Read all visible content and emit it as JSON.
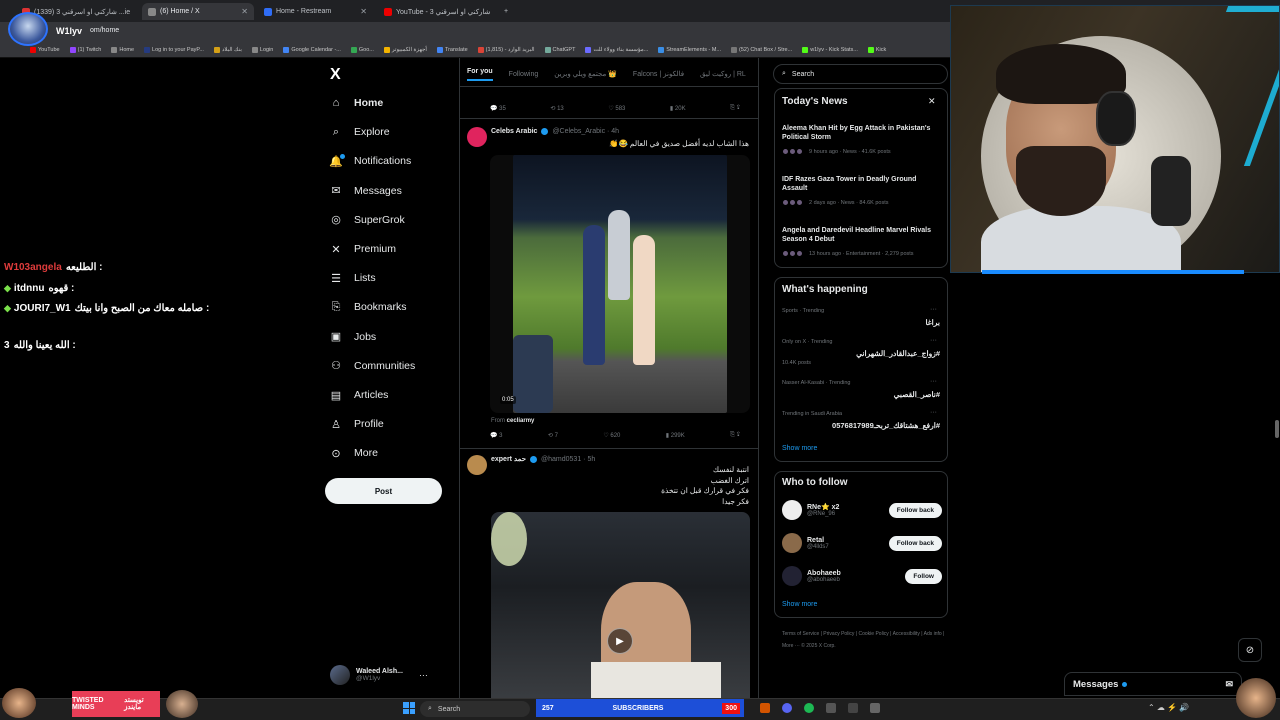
{
  "browser": {
    "tabs": [
      {
        "label": "شاركني او اسرقني 3 (1339) ...ie",
        "color": "#d33"
      },
      {
        "label": "(6) Home / X",
        "color": "#888"
      },
      {
        "label": "Home - Restream",
        "color": "#2f6df6"
      },
      {
        "label": "YouTube - شاركني او اسرقني 3",
        "color": "#e00"
      }
    ],
    "url": "om/home",
    "streamer_name": "W1lyv",
    "bookmarks": [
      "YouTube",
      "(1) Twitch",
      "Home",
      "Log in to your PayP...",
      "بنك البلاد",
      "Login",
      "Google Calendar -...",
      "Goo...",
      "أجهزة الكمبيوتر",
      "Translate",
      "البريد الوارد - (1,815)",
      "ChatGPT",
      "مؤسسة بناء وولاء للت...",
      "StreamElements - M...",
      "(52) Chat Box / Stre...",
      "w1lyv - Kick Stats...",
      "Kick"
    ]
  },
  "chat": [
    {
      "user": "W103angela",
      "msg": "الطليعه :",
      "color": "#e03c3c",
      "badge": false
    },
    {
      "user": "itdnnu",
      "msg": "قهوه :",
      "color": "#ffffff",
      "badge": true
    },
    {
      "user": "JOURI7_W1",
      "msg": "صامله معاك من الصبح وانا بيتك :",
      "color": "#ffffff",
      "badge": true
    },
    {
      "user": "3",
      "msg": "الله يعينا والله :",
      "color": "#ffffff",
      "badge": false
    }
  ],
  "nav": {
    "logo": "X",
    "items": [
      {
        "label": "Home",
        "icon": "home-icon",
        "glyph": "⌂"
      },
      {
        "label": "Explore",
        "icon": "search-icon",
        "glyph": "⌕"
      },
      {
        "label": "Notifications",
        "icon": "bell-icon",
        "glyph": "🔔"
      },
      {
        "label": "Messages",
        "icon": "mail-icon",
        "glyph": "✉"
      },
      {
        "label": "SuperGrok",
        "icon": "grok-icon",
        "glyph": "◎"
      },
      {
        "label": "Premium",
        "icon": "x-premium-icon",
        "glyph": "✕"
      },
      {
        "label": "Lists",
        "icon": "list-icon",
        "glyph": "☰"
      },
      {
        "label": "Bookmarks",
        "icon": "bookmark-icon",
        "glyph": "⎘"
      },
      {
        "label": "Jobs",
        "icon": "briefcase-icon",
        "glyph": "▣"
      },
      {
        "label": "Communities",
        "icon": "people-icon",
        "glyph": "⚇"
      },
      {
        "label": "Articles",
        "icon": "article-icon",
        "glyph": "▤"
      },
      {
        "label": "Profile",
        "icon": "person-icon",
        "glyph": "♙"
      },
      {
        "label": "More",
        "icon": "more-circle-icon",
        "glyph": "⊙"
      }
    ],
    "post_label": "Post",
    "account": {
      "name": "Waleed Alsh...",
      "handle": "@W1lyv"
    }
  },
  "timeline": {
    "tabs": [
      "For you",
      "Following",
      "مجتمع ويلي وبرين 👑",
      "Falcons | فالكونز",
      "روكيت ليق | RL"
    ],
    "top_actions": {
      "replies": "35",
      "reposts": "13",
      "likes": "583",
      "views": "20K"
    },
    "tweet1": {
      "name": "Celebs Arabic",
      "handle": "@Celebs_Arabic · 4h",
      "text": "هذا الشاب لديه أفضل صديق في العالم 😂👏",
      "video_time": "0:05",
      "from_label": "From",
      "from_name": "cecliarmy",
      "actions": {
        "replies": "3",
        "reposts": "7",
        "likes": "620",
        "views": "299K"
      }
    },
    "tweet2": {
      "name": "expert حمد",
      "handle": "@hamd0531 · 5h",
      "lines": [
        "انتبة لنفسك",
        "اترك الغضب",
        "فكر في قرارك قبل ان تتخذة",
        "فكر جيدا"
      ]
    }
  },
  "right": {
    "search_placeholder": "Search",
    "news_title": "Today's News",
    "news": [
      {
        "title": "Aleema Khan Hit by Egg Attack in Pakistan's Political Storm",
        "meta": "9 hours ago · News · 41.6K posts"
      },
      {
        "title": "IDF Razes Gaza Tower in Deadly Ground Assault",
        "meta": "2 days ago · News · 84.6K posts"
      },
      {
        "title": "Angela and Daredevil Headline Marvel Rivals Season 4 Debut",
        "meta": "13 hours ago · Entertainment · 2,279 posts"
      }
    ],
    "happening_title": "What's happening",
    "trends": [
      {
        "context": "Sports · Trending",
        "name": "براغا",
        "posts": ""
      },
      {
        "context": "Only on X · Trending",
        "name": "#زواج_عبدالقادر_الشهراني",
        "posts": "10.4K posts"
      },
      {
        "context": "Nasser Al-Kasabi · Trending",
        "name": "#ناصر_القصبي",
        "posts": ""
      },
      {
        "context": "Trending in Saudi Arabia",
        "name": "#ارفع_هشتاقك_تربحـ0576817989",
        "posts": ""
      }
    ],
    "show_more": "Show more",
    "who_title": "Who to follow",
    "follow": [
      {
        "name": "RNe⭐ x2",
        "handle": "@RNe_96",
        "button": "Follow back"
      },
      {
        "name": "Retal",
        "handle": "@4llds7",
        "button": "Follow back"
      },
      {
        "name": "Abohaeeb",
        "handle": "@abohaeeb",
        "button": "Follow"
      }
    ],
    "footer": "Terms of Service | Privacy Policy | Cookie Policy | Accessibility | Ads info | More ··· © 2025 X Corp."
  },
  "taskbar": {
    "search": "Search",
    "subs_count": "257",
    "subs_label": "SUBSCRIBERS",
    "subs_goal": "300",
    "twisted": "TWISTED MINDS",
    "twisted_ar": "تويستد مايندز"
  },
  "messages_label": "Messages"
}
